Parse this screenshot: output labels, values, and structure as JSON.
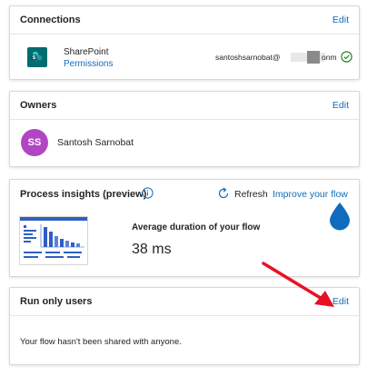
{
  "connections": {
    "title": "Connections",
    "edit_label": "Edit",
    "item": {
      "name": "SharePoint",
      "permissions_label": "Permissions",
      "account_prefix": "santoshsarnobat@",
      "account_suffix": "onm"
    }
  },
  "owners": {
    "title": "Owners",
    "edit_label": "Edit",
    "owner": {
      "initials": "SS",
      "name": "Santosh Sarnobat"
    }
  },
  "insights": {
    "title": "Process insights (preview)",
    "refresh_label": "Refresh",
    "improve_label": "Improve your flow",
    "metric_label": "Average duration of your flow",
    "metric_value": "38 ms"
  },
  "run_only_users": {
    "title": "Run only users",
    "edit_label": "Edit",
    "empty_message": "Your flow hasn't been shared with anyone."
  },
  "colors": {
    "link": "#0f6cbd",
    "sharepoint": "#036c70",
    "avatar": "#b146c2",
    "success": "#107c10",
    "drop": "#0f6cbd",
    "annotation_arrow": "#e81123"
  }
}
